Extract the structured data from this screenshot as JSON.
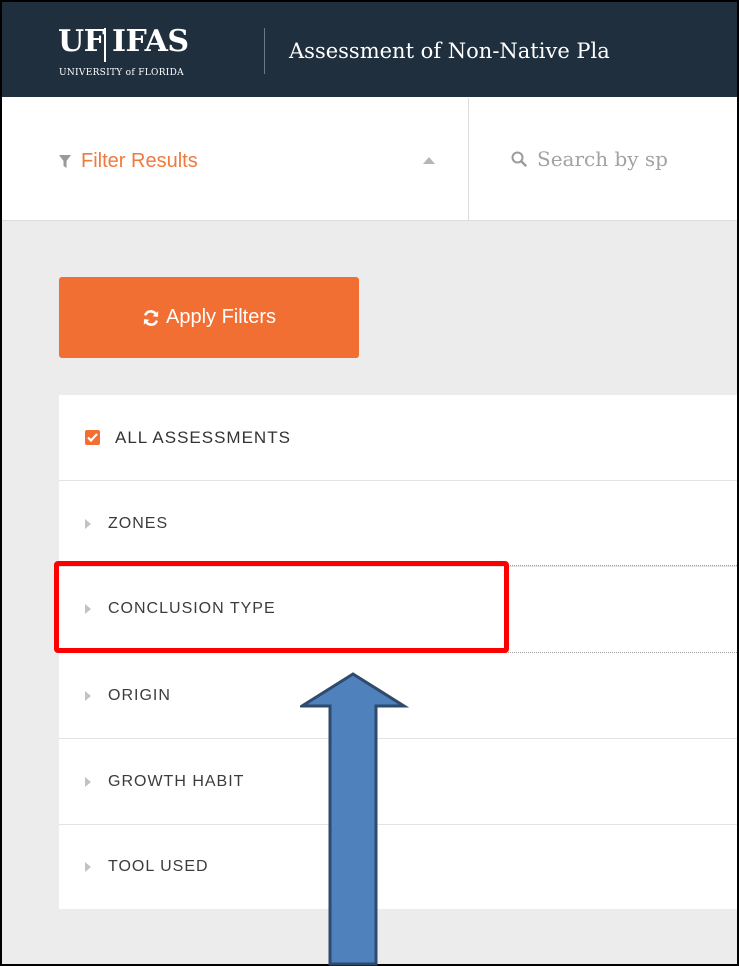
{
  "header": {
    "logo_uf": "UF",
    "logo_ifas": "IFAS",
    "logo_sub": "UNIVERSITY of FLORIDA",
    "app_title": "Assessment of Non-Native Pla"
  },
  "toolbar": {
    "filter_label": "Filter Results",
    "search_placeholder": "Search by sp"
  },
  "sidebar": {
    "apply_label": "Apply Filters",
    "all_label": "ALL ASSESSMENTS",
    "all_checked": true,
    "filters": [
      {
        "label": "ZONES"
      },
      {
        "label": "CONCLUSION TYPE"
      },
      {
        "label": "ORIGIN"
      },
      {
        "label": "GROWTH HABIT"
      },
      {
        "label": "TOOL USED"
      }
    ]
  },
  "annotation": {
    "highlight_color": "#ff0000",
    "arrow_color": "#4f81bd"
  },
  "colors": {
    "accent": "#f26f33",
    "header_bg": "#1f2f3e"
  }
}
